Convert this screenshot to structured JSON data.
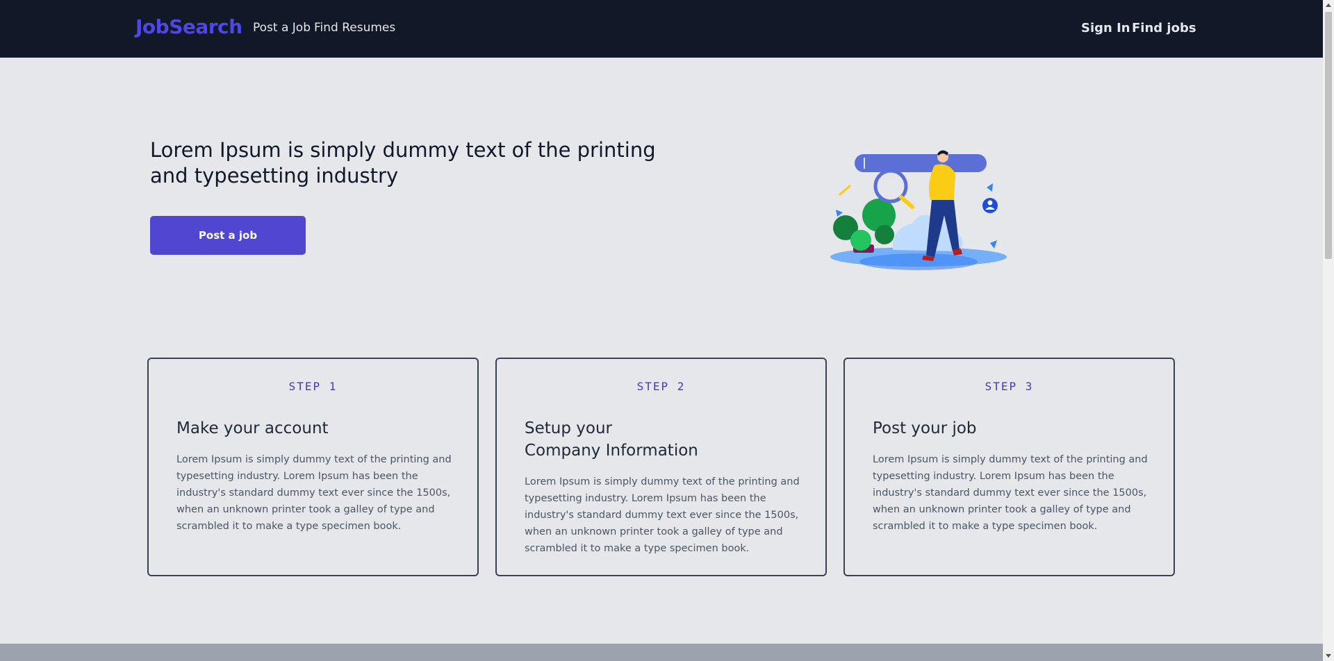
{
  "header": {
    "brand": "JobSearch",
    "nav_left": [
      "Post a Job",
      "Find Resumes"
    ],
    "nav_right": [
      "Sign In",
      "Find jobs"
    ]
  },
  "hero": {
    "title": "Lorem Ipsum is simply dummy text of the printing and typesetting industry",
    "button_label": "Post a job",
    "illustration": "job-search-illustration"
  },
  "steps": [
    {
      "label": "STEP 1",
      "title": "Make your account",
      "body": "Lorem Ipsum is simply dummy text of the printing and typesetting industry. Lorem Ipsum has been the industry's standard dummy text ever since the 1500s, when an unknown printer took a galley of type and scrambled it to make a type specimen book."
    },
    {
      "label": "STEP 2",
      "title": "Setup your\nCompany Information",
      "body": "Lorem Ipsum is simply dummy text of the printing and typesetting industry. Lorem Ipsum has been the industry's standard dummy text ever since the 1500s, when an unknown printer took a galley of type and scrambled it to make a type specimen book."
    },
    {
      "label": "STEP 3",
      "title": "Post your job",
      "body": "Lorem Ipsum is simply dummy text of the printing and typesetting industry. Lorem Ipsum has been the industry's standard dummy text ever since the 1500s, when an unknown printer took a galley of type and scrambled it to make a type specimen book."
    }
  ],
  "colors": {
    "header_bg": "#111827",
    "brand": "#4f46e5",
    "button": "#5046d0",
    "page_bg": "#e5e7eb",
    "step_label": "#4338ca"
  }
}
